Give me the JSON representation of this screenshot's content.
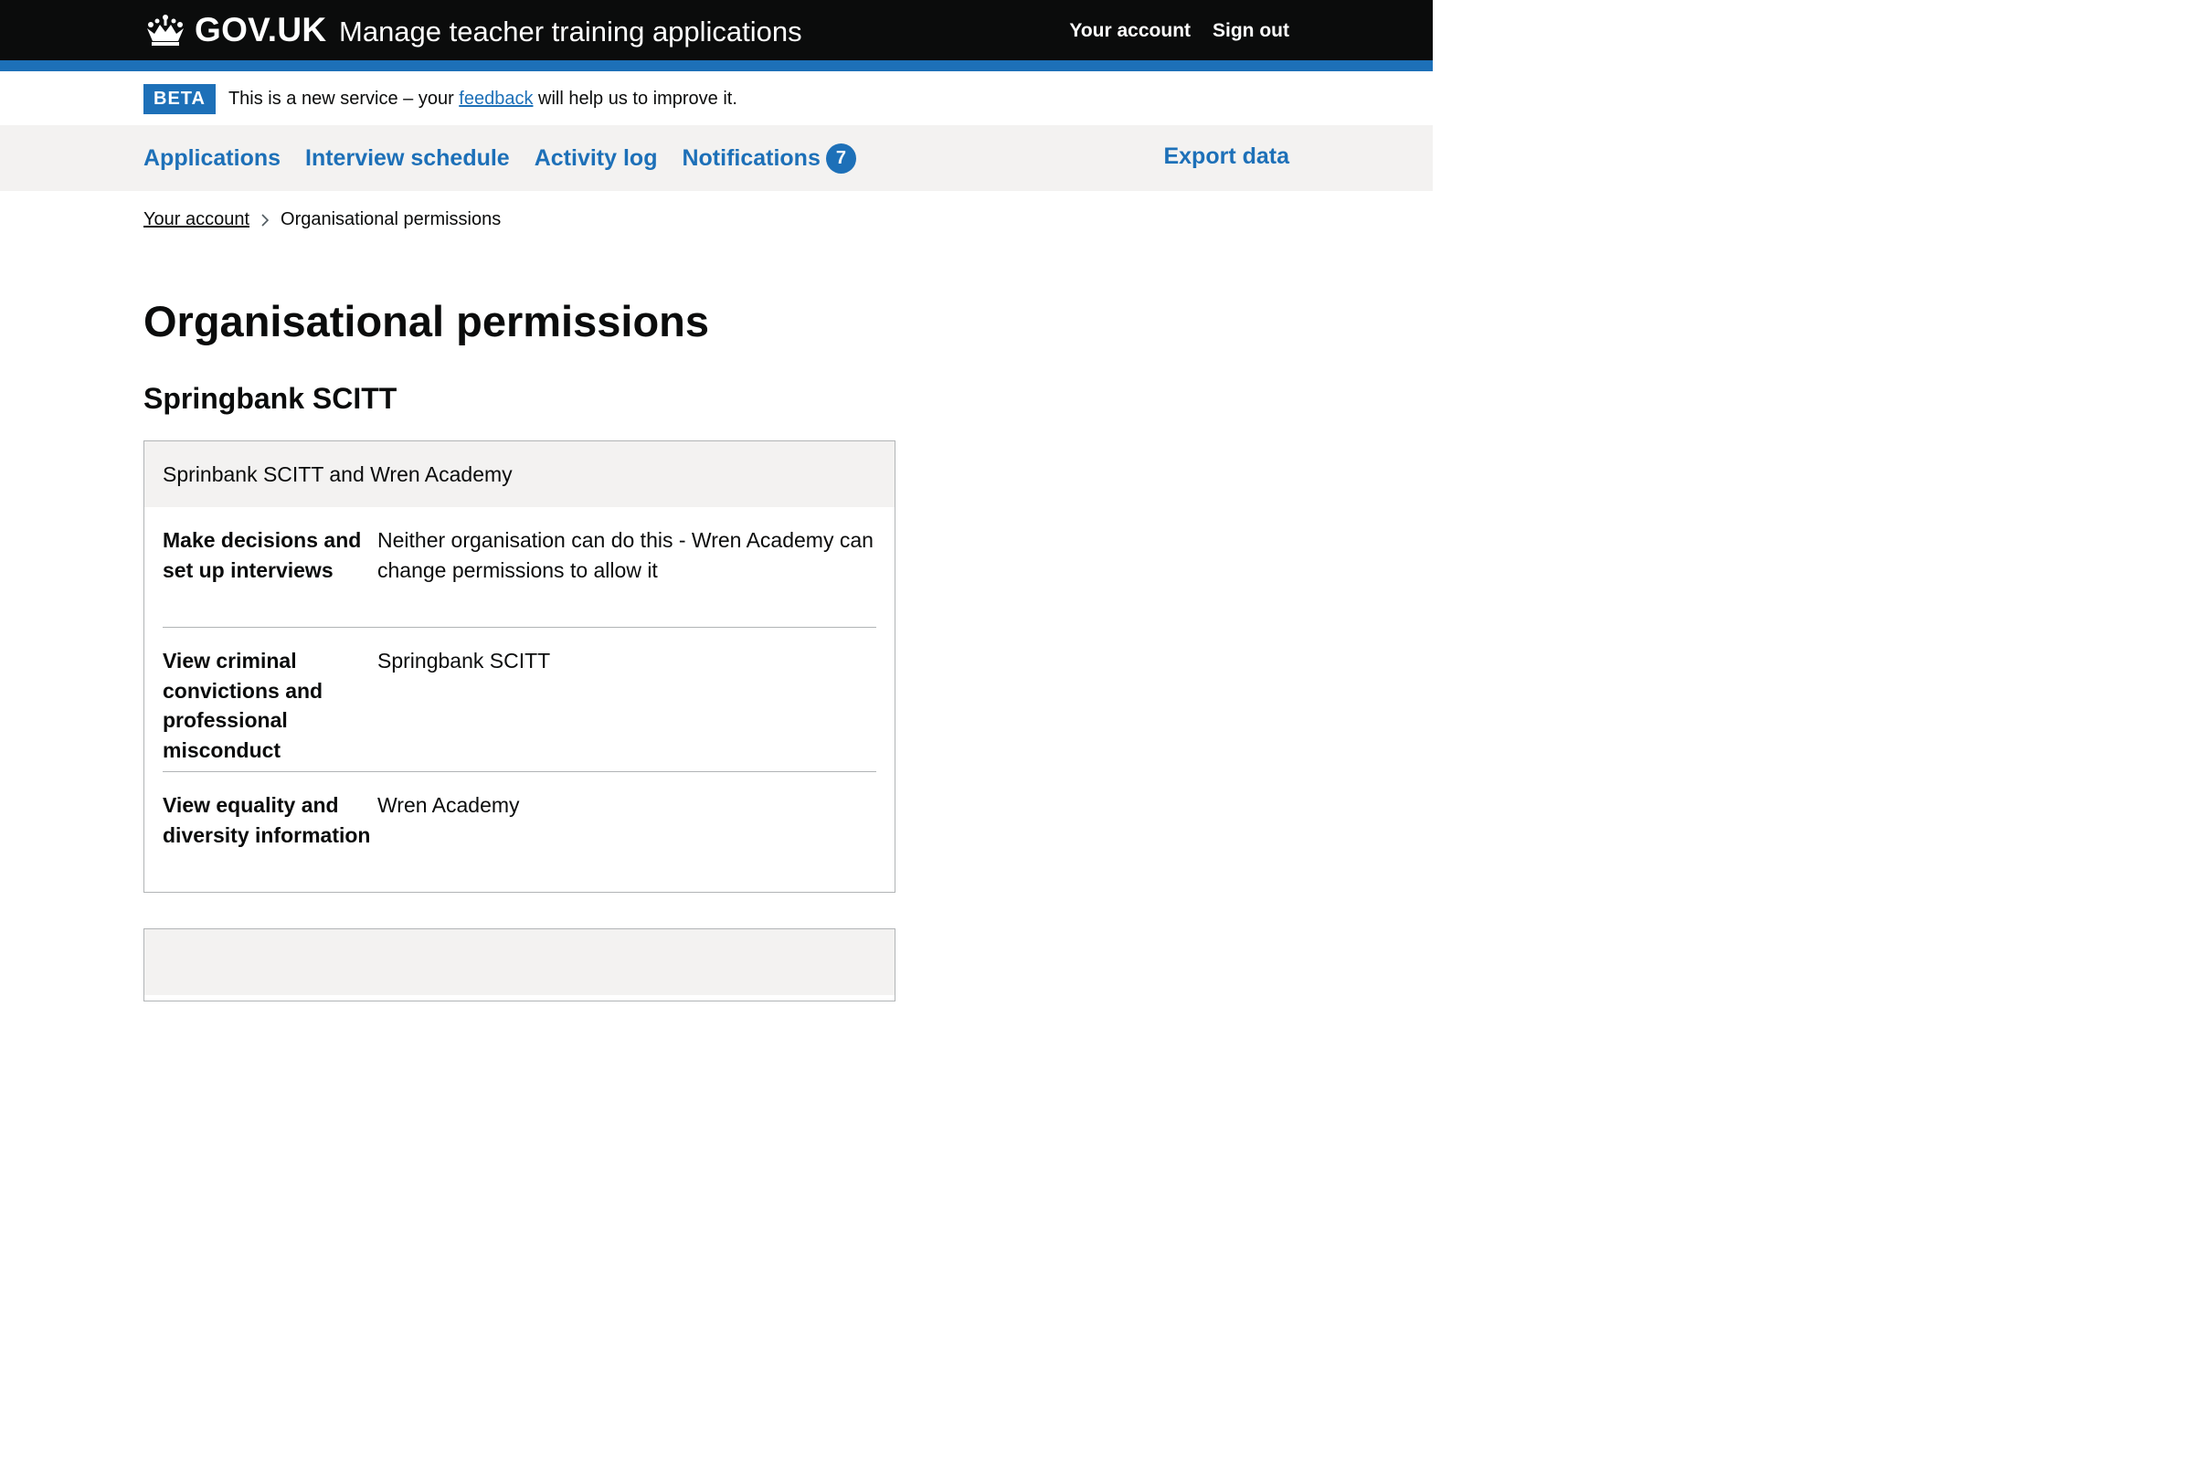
{
  "header": {
    "logo_text": "GOV.UK",
    "service_name": "Manage teacher training applications",
    "links": {
      "your_account": "Your account",
      "sign_out": "Sign out"
    }
  },
  "phase_banner": {
    "tag": "BETA",
    "text_before": "This is a new service – your ",
    "link": "feedback",
    "text_after": " will help us to improve it."
  },
  "nav": {
    "items": [
      {
        "label": "Applications"
      },
      {
        "label": "Interview schedule"
      },
      {
        "label": "Activity log"
      },
      {
        "label": "Notifications",
        "count": "7"
      }
    ],
    "export": "Export data"
  },
  "breadcrumbs": {
    "items": [
      "Your account",
      "Organisational permissions"
    ]
  },
  "page_title": "Organisational permissions",
  "organisation": "Springbank SCITT",
  "card": {
    "title": "Sprinbank SCITT and Wren Academy",
    "rows": [
      {
        "key": "Make decisions and set up interviews",
        "value": "Neither organisation can do this - Wren Academy can change permissions to allow it"
      },
      {
        "key": "View criminal convictions and professional misconduct",
        "value": "Springbank SCITT"
      },
      {
        "key": "View equality and diversity information",
        "value": "Wren Academy"
      }
    ]
  },
  "colors": {
    "header_bg": "#0b0c0c",
    "brand_blue": "#1d70b8",
    "nav_bg": "#f3f2f1",
    "border": "#b1b4b6"
  }
}
